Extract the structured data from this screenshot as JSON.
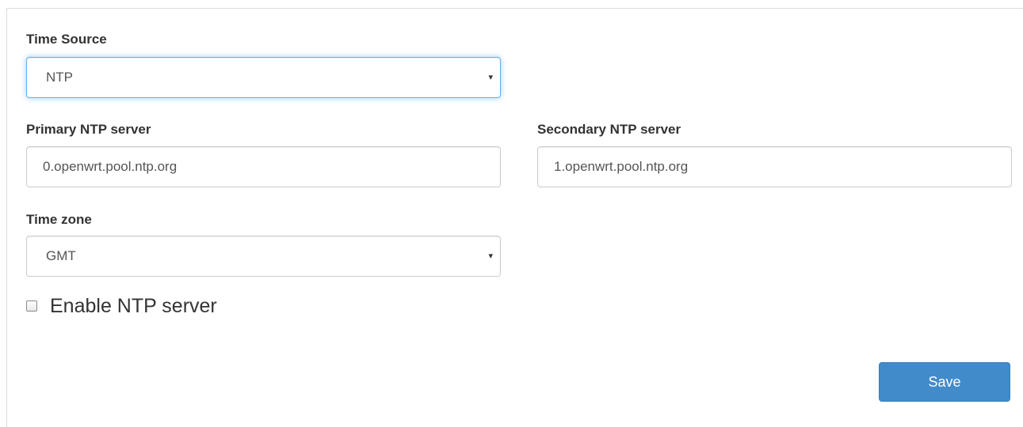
{
  "form": {
    "time_source": {
      "label": "Time Source",
      "selected": "NTP"
    },
    "primary_ntp": {
      "label": "Primary NTP server",
      "value": "0.openwrt.pool.ntp.org"
    },
    "secondary_ntp": {
      "label": "Secondary NTP server",
      "value": "1.openwrt.pool.ntp.org"
    },
    "time_zone": {
      "label": "Time zone",
      "selected": "GMT"
    },
    "enable_ntp_server": {
      "label": "Enable NTP server",
      "checked": false
    },
    "save_label": "Save"
  },
  "icons": {
    "select_caret": "▾"
  },
  "colors": {
    "primary_button": "#428bca",
    "focus_border": "#66afe9"
  }
}
